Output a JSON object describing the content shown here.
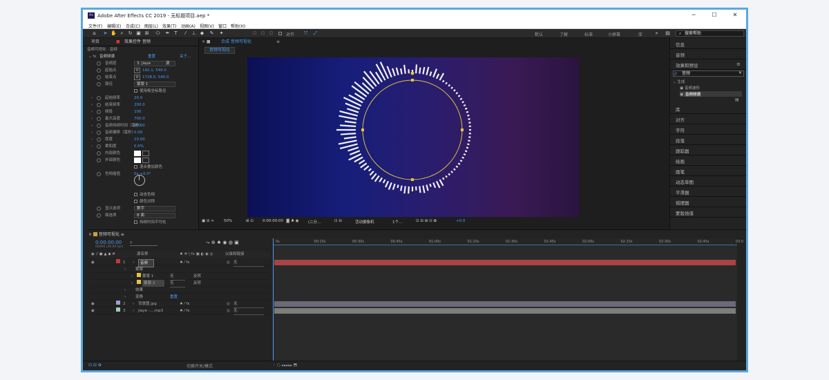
{
  "window": {
    "title": "Adobe After Effects CC 2019 - 无标题项目.aep *",
    "app_icon_text": "Ae",
    "minimize": "─",
    "maximize": "☐",
    "close": "✕"
  },
  "menu": [
    "文件(F)",
    "编辑(E)",
    "合成(C)",
    "图层(L)",
    "效果(T)",
    "动画(A)",
    "视图(V)",
    "窗口",
    "帮助(H)"
  ],
  "toolbar": {
    "snap_label": "对齐",
    "workspaces": [
      "默认",
      "了解",
      "标准",
      "小屏幕",
      "库"
    ],
    "search_placeholder": "搜索帮助"
  },
  "effects_panel": {
    "tabs": [
      "项目",
      "效果控件 音频"
    ],
    "breadcrumb": "音频可视化 · 音频",
    "effect_name": "音频频谱",
    "reset": "重置",
    "about": "关于...",
    "props": [
      {
        "label": "音频层",
        "value": "3. jiaye",
        "extra": "源"
      },
      {
        "label": "起始点",
        "value": "192.1, 540.0"
      },
      {
        "label": "结束点",
        "value": "1728.0, 540.0"
      },
      {
        "label": "路径",
        "value": "蒙版 1"
      },
      {
        "label": "",
        "value": "使用极坐标路径"
      },
      {
        "label": "起始频率",
        "value": "20.0"
      },
      {
        "label": "结束频率",
        "value": "200.0"
      },
      {
        "label": "频段",
        "value": "100"
      },
      {
        "label": "最大高度",
        "value": "700.0"
      },
      {
        "label": "音频持续时间（毫秒）",
        "value": "90.00"
      },
      {
        "label": "音频偏移（毫秒）",
        "value": "0.00"
      },
      {
        "label": "厚度",
        "value": "10.00"
      },
      {
        "label": "柔和度",
        "value": "0.0%"
      },
      {
        "label": "内部颜色",
        "value": ""
      },
      {
        "label": "外部颜色",
        "value": ""
      },
      {
        "label": "",
        "value": "混合叠加颜色"
      },
      {
        "label": "色相插值",
        "value": "0x +0.0°"
      },
      {
        "label": "",
        "value": ""
      },
      {
        "label": "",
        "value": "动态色相"
      },
      {
        "label": "",
        "value": "颜色对称"
      },
      {
        "label": "显示选项",
        "value": "数字"
      },
      {
        "label": "面选项",
        "value": "B 面"
      },
      {
        "label": "",
        "value": "持续时间平均化"
      }
    ]
  },
  "comp_panel": {
    "tab": "合成 音频可视化",
    "subtab": "音频可视化",
    "zoom": "50%",
    "timecode": "0:00:00:00",
    "resolution": "(二分...",
    "camera": "活动摄像机",
    "views": "1个...",
    "exposure": "+0.0"
  },
  "right_panel": {
    "sections": [
      "信息",
      "音频",
      "效果和预设",
      "库",
      "对齐",
      "字符",
      "段落",
      "跟踪器",
      "绘画",
      "画笔",
      "动态草图",
      "平滑器",
      "摇摆器",
      "蒙版插值"
    ],
    "search_value": "音频",
    "tree_folder": "生成",
    "tree_items": [
      "音频波形",
      "音频频谱"
    ]
  },
  "timeline": {
    "comp_name": "音频可视化",
    "timecode": "0:00:00:00",
    "fps": "00000 (30.00 fps)",
    "col_source": "源名称",
    "col_parent": "父级和链接",
    "ruler": [
      "0s",
      "00:15s",
      "00:30s",
      "00:45s",
      "01:00s",
      "01:15s",
      "01:30s",
      "01:45s",
      "02:00s",
      "02:15s",
      "02:30s",
      "02:45s",
      "03:0"
    ],
    "layers": [
      {
        "num": "1",
        "name": "音频",
        "color": "#c83a3a",
        "parent": "无",
        "bar": "#a84444"
      },
      {
        "num": "",
        "name": "蒙版",
        "color": "",
        "parent": "",
        "bar": ""
      },
      {
        "num": "",
        "name": "蒙版 1",
        "color": "#e8c43a",
        "parent": "无",
        "mode": "反转",
        "bar": ""
      },
      {
        "num": "",
        "name": "蒙版 2",
        "color": "#e8c43a",
        "parent": "无",
        "mode": "反转",
        "bar": ""
      },
      {
        "num": "",
        "name": "效果",
        "color": "",
        "parent": "",
        "bar": ""
      },
      {
        "num": "",
        "name": "变换",
        "color": "",
        "parent": "重置",
        "bar": ""
      },
      {
        "num": "2",
        "name": "背景图.jpg",
        "color": "#9a9fd8",
        "parent": "无",
        "bar": "#6a6a78"
      },
      {
        "num": "3",
        "name": "jiaye -....mp3",
        "color": "#9fd0b0",
        "parent": "无",
        "bar": "#7a7f7a"
      }
    ],
    "switch_label": "切换开关/模式"
  },
  "colors": {
    "accent": "#4d9bf5",
    "frame": "#5aa7e2",
    "ring": "#e3c441"
  }
}
